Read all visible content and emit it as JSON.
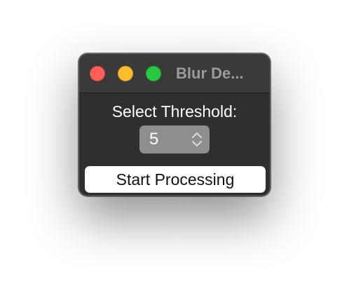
{
  "window": {
    "title": "Blur De..."
  },
  "controls": {
    "threshold_label": "Select Threshold:",
    "threshold_value": "5",
    "start_button_label": "Start Processing"
  },
  "colors": {
    "close": "#ff5f57",
    "minimize": "#febc2e",
    "zoom": "#28c840",
    "window_background": "#2f2f2f",
    "stepper_background": "#8e8e8e"
  }
}
